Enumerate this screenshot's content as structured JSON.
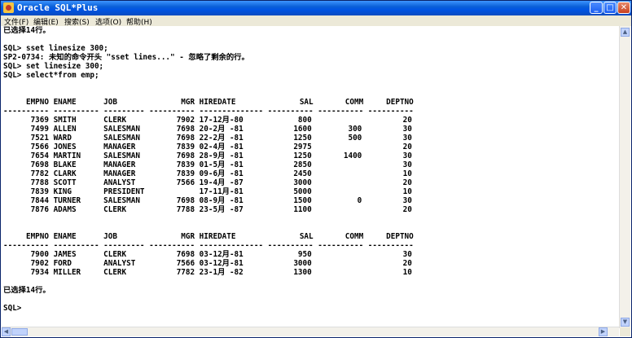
{
  "window": {
    "title": "Oracle SQL*Plus"
  },
  "menu": [
    "文件(F)",
    "编辑(E)",
    "搜索(S)",
    "选项(O)",
    "帮助(H)"
  ],
  "console_lines": [
    "已选择14行。",
    "",
    "SQL> sset linesize 300;",
    "SP2-0734: 未知的命令开头 \"sset lines...\" - 忽略了剩余的行。",
    "SQL> set linesize 300;",
    "SQL> select*from emp;",
    "",
    "     EMPNO ENAME      JOB              MGR HIREDATE              SAL       COMM     DEPTNO",
    "---------- ---------- --------- ---------- -------------- ---------- ---------- ----------",
    "      7369 SMITH      CLERK           7902 17-12月-80            800                    20",
    "      7499 ALLEN      SALESMAN        7698 20-2月 -81           1600        300         30",
    "      7521 WARD       SALESMAN        7698 22-2月 -81           1250        500         30",
    "      7566 JONES      MANAGER         7839 02-4月 -81           2975                    20",
    "      7654 MARTIN     SALESMAN        7698 28-9月 -81           1250       1400         30",
    "      7698 BLAKE      MANAGER         7839 01-5月 -81           2850                    30",
    "      7782 CLARK      MANAGER         7839 09-6月 -81           2450                    10",
    "      7788 SCOTT      ANALYST         7566 19-4月 -87           3000                    20",
    "      7839 KING       PRESIDENT            17-11月-81           5000                    10",
    "      7844 TURNER     SALESMAN        7698 08-9月 -81           1500          0         30",
    "      7876 ADAMS      CLERK           7788 23-5月 -87           1100                    20",
    "",
    "     EMPNO ENAME      JOB              MGR HIREDATE              SAL       COMM     DEPTNO",
    "---------- ---------- --------- ---------- -------------- ---------- ---------- ----------",
    "      7900 JAMES      CLERK           7698 03-12月-81            950                    30",
    "      7902 FORD       ANALYST         7566 03-12月-81           3000                    20",
    "      7934 MILLER     CLERK           7782 23-1月 -82           1300                    10",
    "",
    "已选择14行。",
    "",
    "SQL>"
  ]
}
